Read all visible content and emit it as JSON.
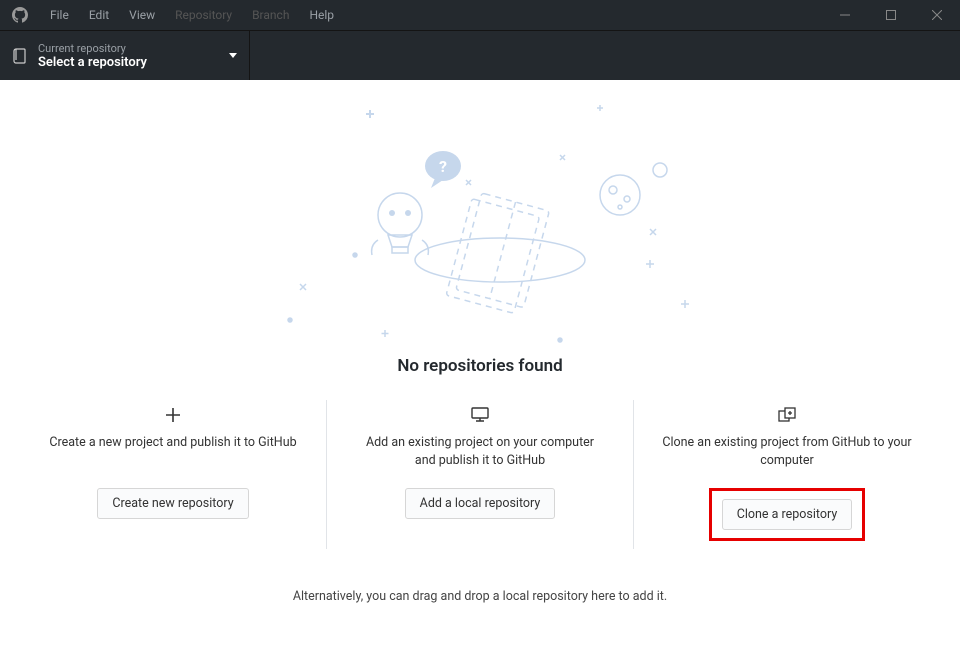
{
  "menubar": {
    "items": [
      "File",
      "Edit",
      "View",
      "Repository",
      "Branch",
      "Help"
    ]
  },
  "repoSelector": {
    "label": "Current repository",
    "value": "Select a repository"
  },
  "main": {
    "heading": "No repositories found",
    "options": [
      {
        "desc": "Create a new project and publish it to GitHub",
        "button": "Create new repository"
      },
      {
        "desc": "Add an existing project on your computer and publish it to GitHub",
        "button": "Add a local repository"
      },
      {
        "desc": "Clone an existing project from GitHub to your computer",
        "button": "Clone a repository"
      }
    ],
    "footer": "Alternatively, you can drag and drop a local repository here to add it."
  }
}
